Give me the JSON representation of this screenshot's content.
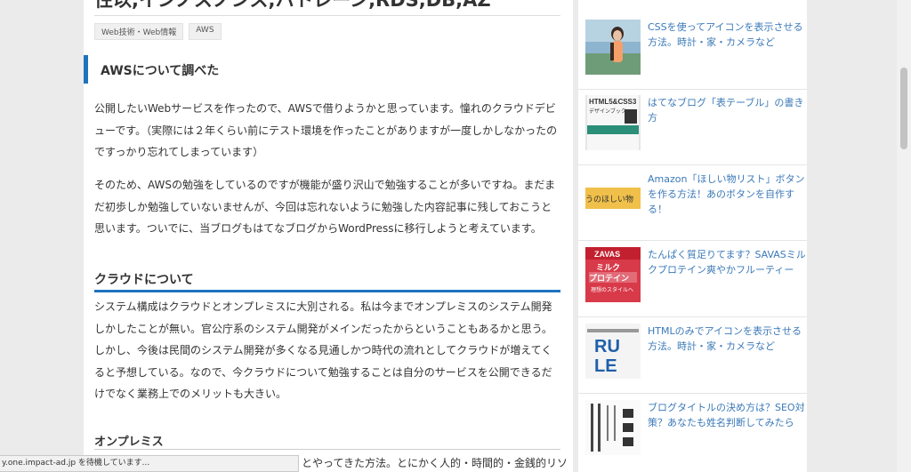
{
  "article": {
    "top_title": "性以,インノスノンス,ハトレーン,RDS,DB,AZ",
    "tags": [
      "Web技術・Web情報",
      "AWS"
    ],
    "h2_aws": "AWSについて調べた",
    "p1": "公開したいWebサービスを作ったので、AWSで借りようかと思っています。憧れのクラウドデビューです。（実際には２年くらい前にテスト環境を作ったことがありますが一度しかしなかったのですっかり忘れてしまっています）",
    "p2": "そのため、AWSの勉強をしているのですが機能が盛り沢山で勉強することが多いですね。まだまだ初歩しか勉強していないませんが、今回は忘れないように勉強した内容記事に残しておこうと思います。ついでに、当ブログもはてなブログからWordPressに移行しようと考えています。",
    "h2_cloud": "クラウドについて",
    "p3": "システム構成はクラウドとオンプレミスに大別される。私は今までオンプレミスのシステム開発しかしたことが無い。官公庁系のシステム開発がメインだったからということもあるかと思う。しかし、今後は民間のシステム開発が多くなる見通しかつ時代の流れとしてクラウドが増えてくると予想している。なので、今クラウドについて勉強することは自分のサービスを公開できるだけでなく業務上でのメリットも大きい。",
    "h3_onprem": "オンプレミス",
    "tail": "とやってきた方法。とにかく人的・時間的・金銭的リソ"
  },
  "sidebar": {
    "items": [
      {
        "title": "CSSを使ってアイコンを表示させる方法。時計・家・カメラなど",
        "thumb": "photo-woman"
      },
      {
        "title": "はてなブログ「表テーブル」の書き方",
        "thumb": "book-html5-css3",
        "thumb_text1": "HTML5&CSS3",
        "thumb_text2": "デザインブック"
      },
      {
        "title": "Amazon「ほしい物リスト」ボタンを作る方法！あのボタンを自作する！",
        "thumb": "wishlist-banner",
        "thumb_text": "うのほしい物"
      },
      {
        "title": "たんぱく質足りてます？SAVASミルクプロテイン爽やかフルーティー",
        "thumb": "savas-package",
        "thumb_text1": "ZAVAS",
        "thumb_text2": "ミルク",
        "thumb_text3": "プロテイン",
        "thumb_text4": "理想のスタイルへ"
      },
      {
        "title": "HTMLのみでアイコンを表示させる方法。時計・家・カメラなど",
        "thumb": "book-rule",
        "thumb_text1": "RU",
        "thumb_text2": "LE"
      },
      {
        "title": "ブログタイトルの決め方は？SEO対策？あなたも姓名判断してみたら",
        "thumb": "book-naming"
      }
    ]
  },
  "status": {
    "text": "y.one.impact-ad.jp を待機しています..."
  },
  "colors": {
    "accent": "#1e73be",
    "link": "#3b79b8",
    "background": "#ebebeb"
  }
}
